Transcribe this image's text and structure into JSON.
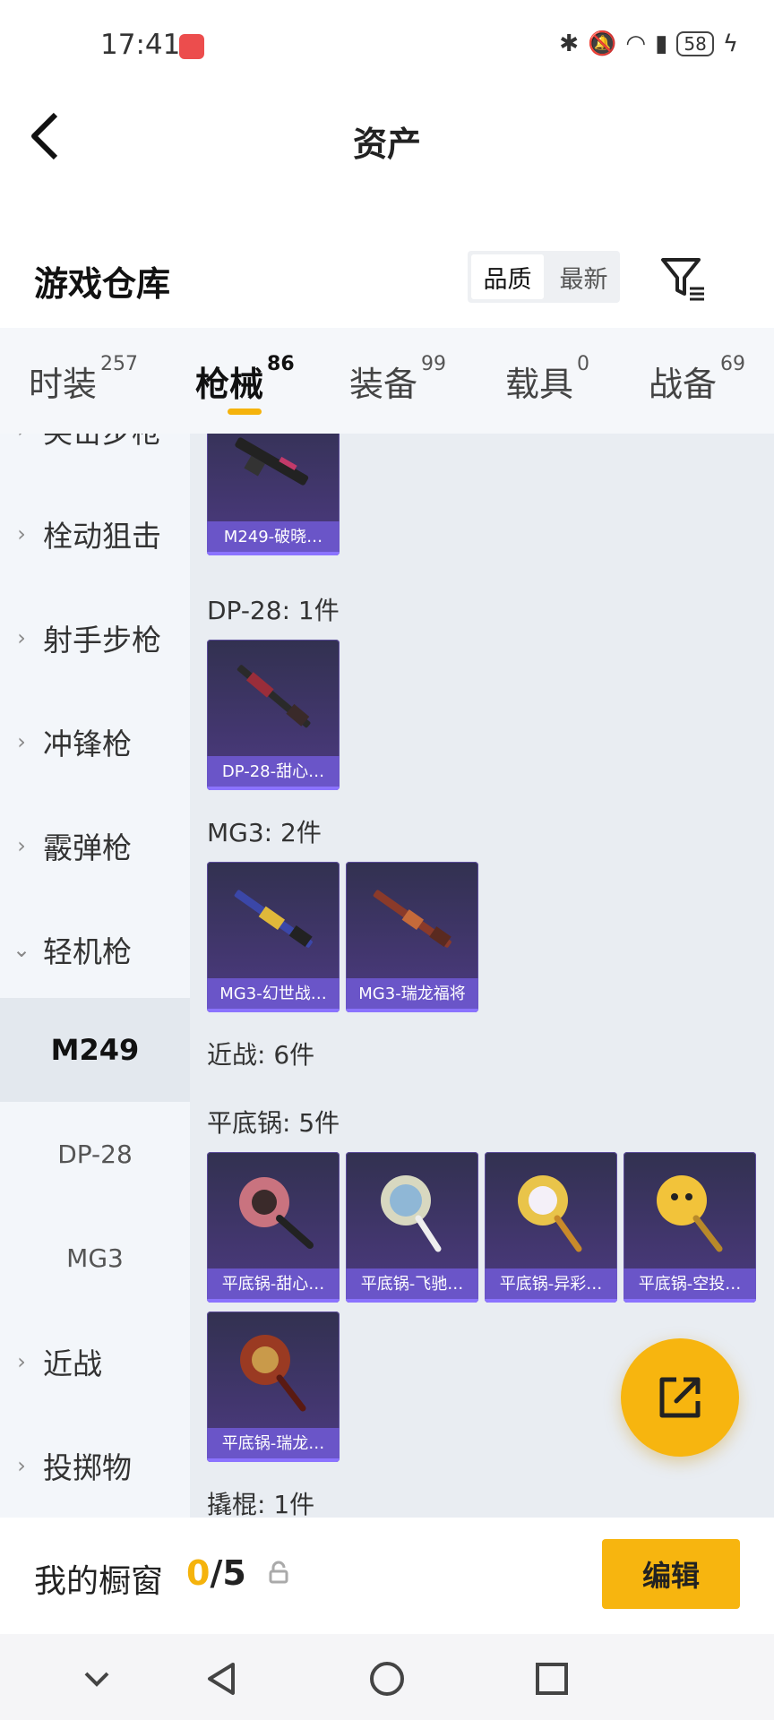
{
  "status_bar": {
    "time": "17:41",
    "battery": "58"
  },
  "header": {
    "title": "资产"
  },
  "warehouse": {
    "title": "游戏仓库",
    "sort_options": [
      "品质",
      "最新"
    ]
  },
  "tabs": [
    {
      "label": "时装",
      "count": "257"
    },
    {
      "label": "枪械",
      "count": "86"
    },
    {
      "label": "装备",
      "count": "99"
    },
    {
      "label": "载具",
      "count": "0"
    },
    {
      "label": "战备",
      "count": "69"
    }
  ],
  "sidebar": {
    "items": [
      {
        "label": "突击步枪"
      },
      {
        "label": "栓动狙击"
      },
      {
        "label": "射手步枪"
      },
      {
        "label": "冲锋枪"
      },
      {
        "label": "霰弹枪"
      },
      {
        "label": "轻机枪"
      }
    ],
    "subitems": [
      {
        "label": "M249"
      },
      {
        "label": "DP-28"
      },
      {
        "label": "MG3"
      }
    ],
    "more_items": [
      {
        "label": "近战"
      },
      {
        "label": "投掷物"
      }
    ]
  },
  "content": {
    "groups": [
      {
        "label": "DP-28: 1件"
      },
      {
        "label": "MG3: 2件"
      },
      {
        "label": "近战: 6件"
      },
      {
        "label": "平底锅: 5件"
      },
      {
        "label": "撬棍: 1件"
      }
    ],
    "cards": [
      {
        "name": "M249-破晓…"
      },
      {
        "name": "DP-28-甜心…"
      },
      {
        "name": "MG3-幻世战…"
      },
      {
        "name": "MG3-瑞龙福将"
      },
      {
        "name": "平底锅-甜心…"
      },
      {
        "name": "平底锅-飞驰…"
      },
      {
        "name": "平底锅-异彩…"
      },
      {
        "name": "平底锅-空投…"
      },
      {
        "name": "平底锅-瑞龙…"
      }
    ]
  },
  "showcase": {
    "label": "我的橱窗",
    "current": "0",
    "total": "/5",
    "edit_label": "编辑"
  },
  "colors": {
    "accent": "#f7b50f",
    "card_caption": "#6a55c8"
  }
}
